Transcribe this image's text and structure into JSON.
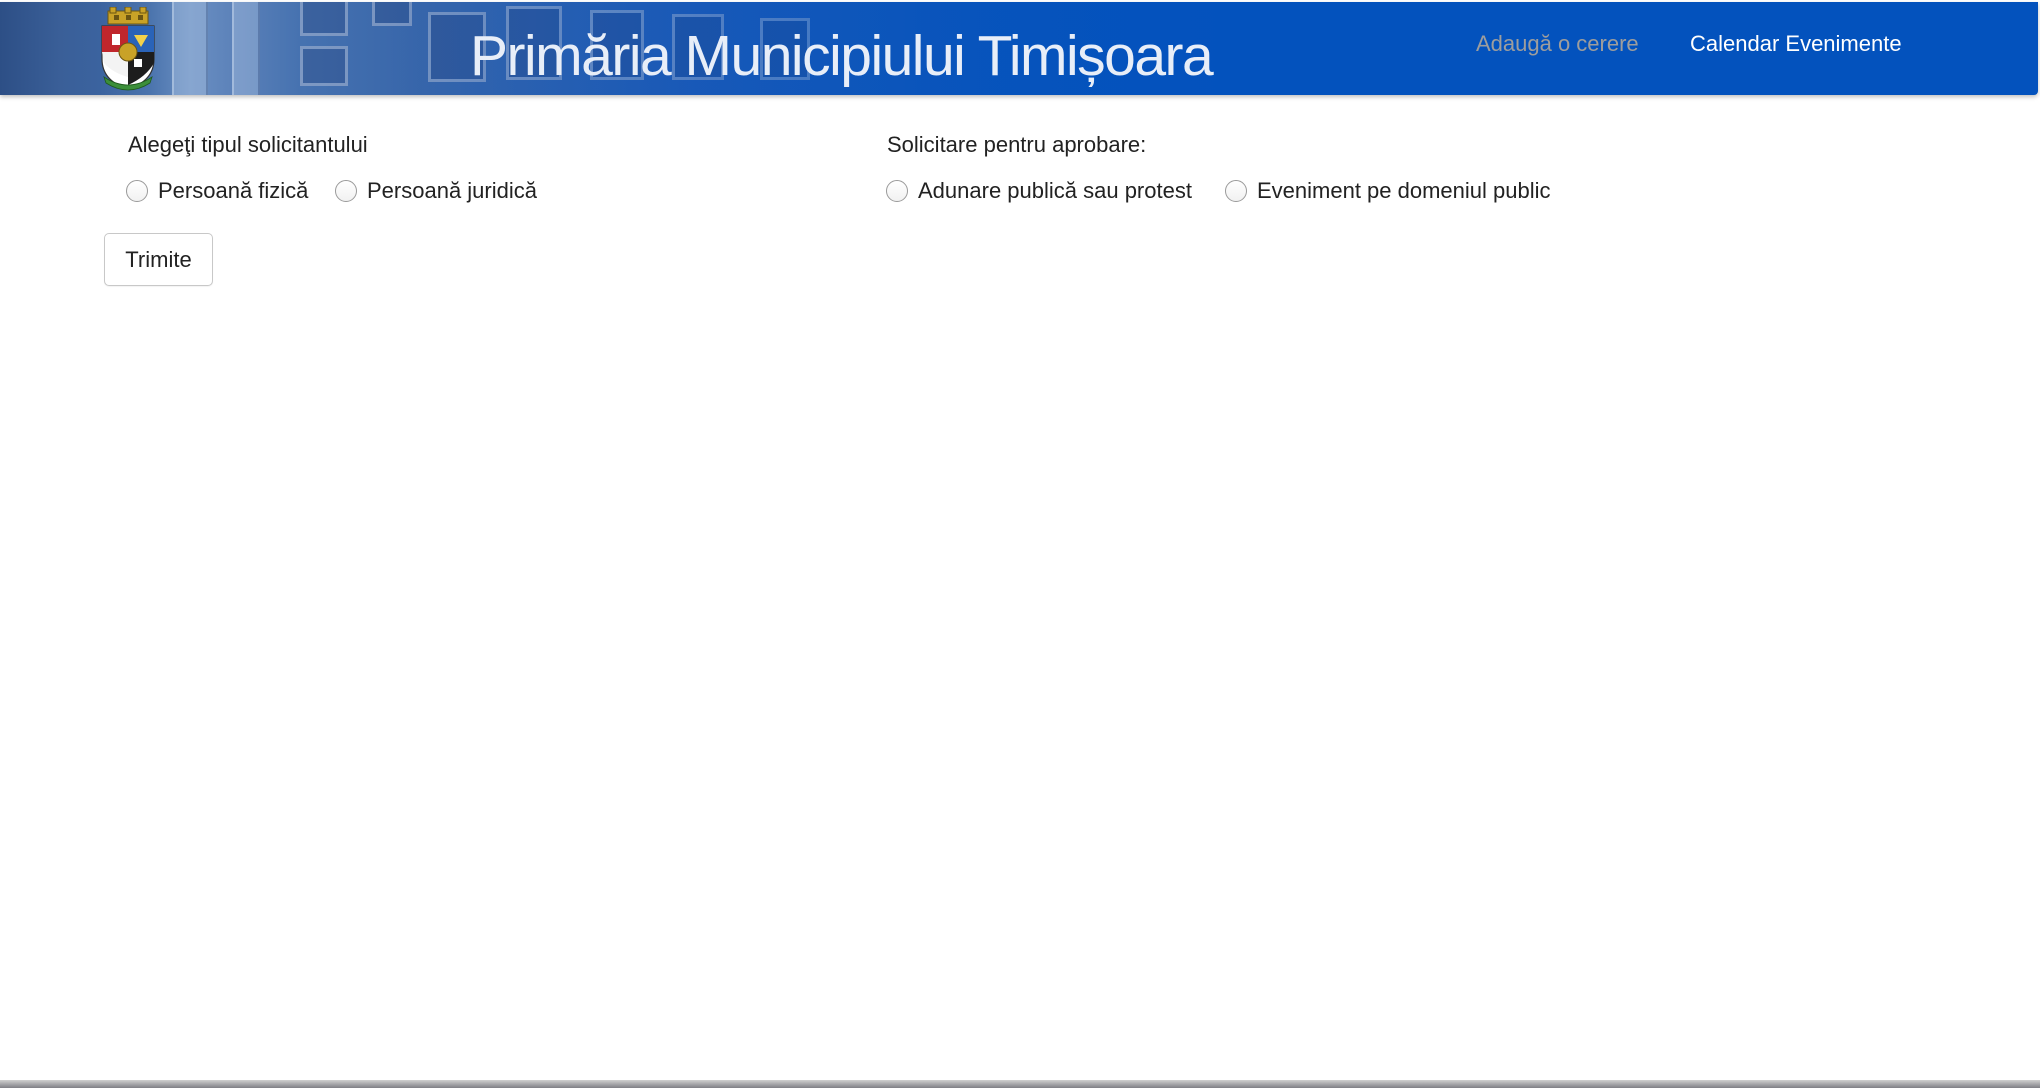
{
  "header": {
    "site_title": "Primăria Municipiului Timișoara",
    "crest_alt": "Stema Municipiului Timișoara",
    "nav": {
      "add_request": "Adaugă o cerere",
      "calendar": "Calendar Evenimente"
    },
    "colors": {
      "background": "#0352bd",
      "nav_inactive": "#9d9d9d",
      "nav_active": "#ffffff"
    }
  },
  "form": {
    "applicant_type": {
      "label": "Alegeţi tipul solicitantului",
      "options": [
        {
          "label": "Persoană fizică",
          "selected": false
        },
        {
          "label": "Persoană juridică",
          "selected": false
        }
      ]
    },
    "approval_request": {
      "label": "Solicitare pentru aprobare:",
      "options": [
        {
          "label": "Adunare publică sau protest",
          "selected": false
        },
        {
          "label": "Eveniment pe domeniul public",
          "selected": false
        }
      ]
    },
    "submit_label": "Trimite"
  },
  "icons": {
    "crest": "city-coat-of-arms-icon",
    "radio": "radio-button-icon"
  }
}
